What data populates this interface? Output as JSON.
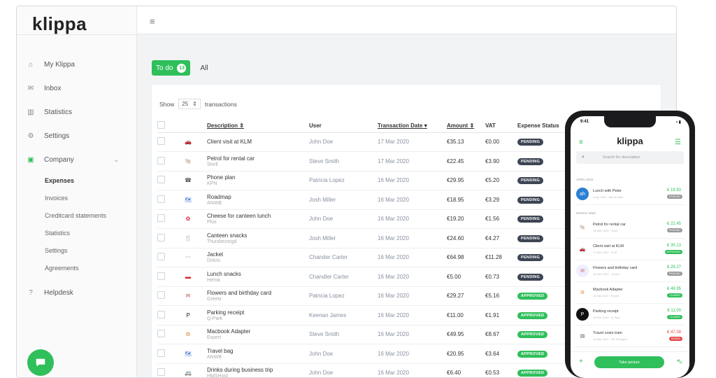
{
  "app": {
    "logo": "klippa"
  },
  "sidebar": {
    "items": [
      {
        "label": "My Klippa",
        "icon": "home-icon"
      },
      {
        "label": "Inbox",
        "icon": "inbox-icon"
      },
      {
        "label": "Statistics",
        "icon": "bar-chart-icon"
      },
      {
        "label": "Settings",
        "icon": "gear-icon"
      },
      {
        "label": "Company",
        "icon": "briefcase-icon"
      }
    ],
    "company_sub": [
      "Expenses",
      "Invoices",
      "Creditcard statements",
      "Statistics",
      "Settings",
      "Agreements"
    ],
    "helpdesk": "Helpdesk"
  },
  "tabs": {
    "todo_label": "To do",
    "todo_count": "13",
    "all_label": "All"
  },
  "table": {
    "show_label": "Show",
    "show_value": "25",
    "show_suffix": "transactions",
    "headers": {
      "description": "Description",
      "user": "User",
      "date": "Transaction Date",
      "amount": "Amount",
      "vat": "VAT",
      "status": "Expense Status"
    },
    "rows": [
      {
        "title": "Client visit at KLM",
        "sub": "",
        "user": "John Doe",
        "date": "17 Mar 2020",
        "amount": "€35.13",
        "vat": "€0.00",
        "status": "PENDING"
      },
      {
        "title": "Petrol for rental car",
        "sub": "Shell",
        "user": "Steve Smith",
        "date": "17 Mar 2020",
        "amount": "€22.45",
        "vat": "€3.90",
        "status": "PENDING"
      },
      {
        "title": "Phone plan",
        "sub": "KPN",
        "user": "Patricia Lopez",
        "date": "16 Mar 2020",
        "amount": "€29.95",
        "vat": "€5.20",
        "status": "PENDING"
      },
      {
        "title": "Roadmap",
        "sub": "ANWB",
        "user": "Josh Miller",
        "date": "16 Mar 2020",
        "amount": "€18.95",
        "vat": "€3.29",
        "status": "PENDING"
      },
      {
        "title": "Cheese for canteen lunch",
        "sub": "Plus",
        "user": "John Doe",
        "date": "16 Mar 2020",
        "amount": "€19.20",
        "vat": "€1.56",
        "status": "PENDING"
      },
      {
        "title": "Canteen snacks",
        "sub": "Thuisbezorgd",
        "user": "Josh Miller",
        "date": "16 Mar 2020",
        "amount": "€24.60",
        "vat": "€4.27",
        "status": "PENDING"
      },
      {
        "title": "Jacket",
        "sub": "Dolcis",
        "user": "Chander Carter",
        "date": "16 Mar 2020",
        "amount": "€64.98",
        "vat": "€11.28",
        "status": "PENDING"
      },
      {
        "title": "Lunch snacks",
        "sub": "Hema",
        "user": "Chandler Carter",
        "date": "16 Mar 2020",
        "amount": "€5.00",
        "vat": "€0.73",
        "status": "PENDING"
      },
      {
        "title": "Flowers and birthday card",
        "sub": "Greetz",
        "user": "Patricia Lopez",
        "date": "16 Mar 2020",
        "amount": "€29.27",
        "vat": "€5.16",
        "status": "APPROVED"
      },
      {
        "title": "Parking receipt",
        "sub": "Q-Park",
        "user": "Keenan James",
        "date": "16 Mar 2020",
        "amount": "€11.00",
        "vat": "€1.91",
        "status": "APPROVED"
      },
      {
        "title": "Macbook Adapter",
        "sub": "Expert",
        "user": "Steve Smith",
        "date": "16 Mar 2020",
        "amount": "€49.95",
        "vat": "€8.67",
        "status": "APPROVED"
      },
      {
        "title": "Travel bag",
        "sub": "ANWB",
        "user": "John Doe",
        "date": "16 Mar 2020",
        "amount": "€20.95",
        "vat": "€3.64",
        "status": "APPROVED"
      },
      {
        "title": "Drinks during business trip",
        "sub": "HMSHost",
        "user": "John Doe",
        "date": "16 Mar 2020",
        "amount": "€6.40",
        "vat": "€0.53",
        "status": "APPROVED"
      }
    ]
  },
  "phone": {
    "time": "9:41",
    "logo": "klippa",
    "search_placeholder": "Search for description",
    "sections": [
      "APRIL 2020",
      "MARCH 2020"
    ],
    "items": [
      {
        "title": "Lunch with Peter",
        "sub": "6 Apr 2020 · Albert Heijn",
        "amount": "€ 19.93",
        "badge": "PENDING",
        "color": "#999"
      },
      {
        "title": "Petrol for rental car",
        "sub": "18 Mar 2020 · Shell",
        "amount": "€ 22.45",
        "badge": "PENDING",
        "color": "#999"
      },
      {
        "title": "Client visit at KLM",
        "sub": "17 Mar 2020 · KLM",
        "amount": "€ 35.13",
        "badge": "APPROVED",
        "color": "#2fbf5b"
      },
      {
        "title": "Flowers and birthday card",
        "sub": "16 Mar 2020 · Greetz",
        "amount": "€ 29.27",
        "badge": "PENDING",
        "color": "#999"
      },
      {
        "title": "Macbook Adapter",
        "sub": "16 Mar 2020 · Expert",
        "amount": "€ 49.95",
        "badge": "CLAIMED",
        "color": "#2fbf5b"
      },
      {
        "title": "Parking receipt",
        "sub": "16 Mar 2020 · Q-Park",
        "amount": "€ 11.00",
        "badge": "CLAIMED",
        "color": "#2fbf5b"
      },
      {
        "title": "Travel costs train",
        "sub": "16 Mar 2020 · NS Reizigers",
        "amount": "€ 47.08",
        "badge": "DENIED",
        "color": "#e54848"
      }
    ],
    "take_picture": "Take picture"
  }
}
